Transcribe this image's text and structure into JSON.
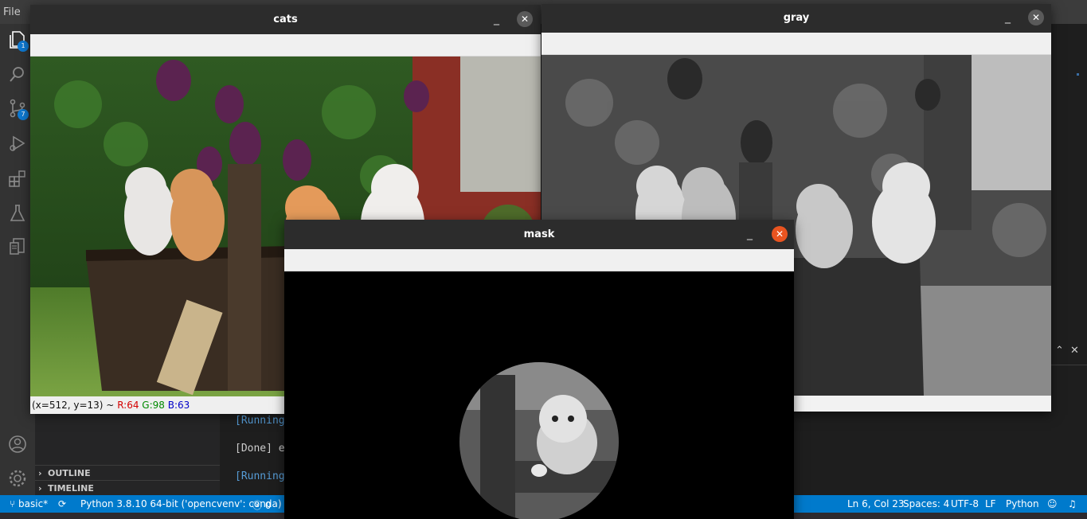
{
  "vscode": {
    "menu": {
      "file": "File"
    },
    "activity": {
      "explorer_badge": "1",
      "scm_badge": "7"
    },
    "sidebar": {
      "outline": "OUTLINE",
      "timeline": "TIMELINE"
    },
    "output": {
      "line1": "[Running",
      "line2": "[Done] e",
      "line3": "[Running"
    },
    "status": {
      "branch": "basic*",
      "interpreter": "Python 3.8.10 64-bit ('opencvenv': conda)",
      "problems": "0",
      "position": "Ln 6, Col 23",
      "spaces": "Spaces: 4",
      "encoding": "UTF-8",
      "eol": "LF",
      "language": "Python"
    }
  },
  "windows": {
    "cats": {
      "title": "cats",
      "pixel_info": {
        "coords": "(x=512, y=13) ~",
        "r": "R:64",
        "g": "G:98",
        "b": "B:63"
      }
    },
    "gray": {
      "title": "gray"
    },
    "mask": {
      "title": "mask"
    }
  },
  "colors": {
    "accent_status": "#007acc",
    "close_active": "#e95420",
    "r_value": "#d40000",
    "g_value": "#008a00",
    "b_value": "#0000c8"
  },
  "icons": [
    "files-icon",
    "search-icon",
    "source-control-icon",
    "run-debug-icon",
    "extensions-icon",
    "flask-icon",
    "remote-explorer-icon",
    "account-icon",
    "settings-gear-icon",
    "branch-icon",
    "sync-icon",
    "error-icon",
    "feedback-icon",
    "bell-icon",
    "close-icon",
    "minimize-icon",
    "chevron-up-icon",
    "chevron-right-icon"
  ]
}
